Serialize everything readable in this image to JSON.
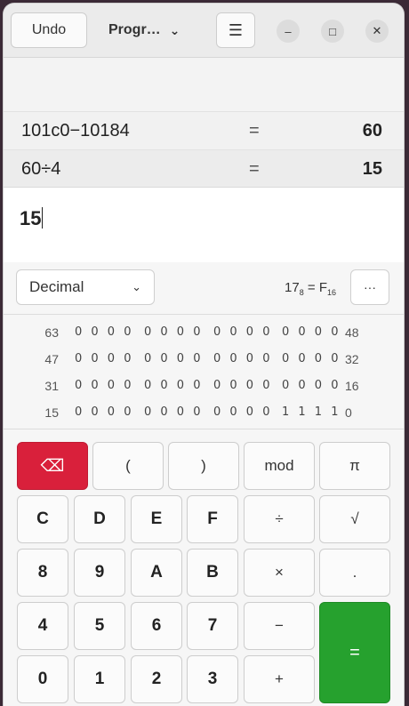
{
  "header": {
    "undo_label": "Undo",
    "mode_label": "Progr…",
    "menu_glyph": "☰",
    "min_glyph": "–",
    "max_glyph": "□",
    "close_glyph": "✕"
  },
  "history": [
    {
      "expr": "101c0−10184",
      "eq": "=",
      "result": "60"
    },
    {
      "expr": "60÷4",
      "eq": "=",
      "result": "15"
    }
  ],
  "input": {
    "value": "15"
  },
  "base": {
    "selected": "Decimal",
    "conv_octal": "17",
    "conv_octal_sub": "8",
    "conv_eq": "=",
    "conv_hex": "F",
    "conv_hex_sub": "16",
    "more_label": "···"
  },
  "bits": [
    {
      "left": "63",
      "n": [
        "0 0 0 0",
        "0 0 0 0",
        "0 0 0 0",
        "0 0 0 0"
      ],
      "right": "48"
    },
    {
      "left": "47",
      "n": [
        "0 0 0 0",
        "0 0 0 0",
        "0 0 0 0",
        "0 0 0 0"
      ],
      "right": "32"
    },
    {
      "left": "31",
      "n": [
        "0 0 0 0",
        "0 0 0 0",
        "0 0 0 0",
        "0 0 0 0"
      ],
      "right": "16"
    },
    {
      "left": "15",
      "n": [
        "0 0 0 0",
        "0 0 0 0",
        "0 0 0 0",
        "1 1 1 1"
      ],
      "right": "0"
    }
  ],
  "keys": {
    "backspace": "⌫",
    "lparen": "(",
    "rparen": ")",
    "mod": "mod",
    "pi": "π",
    "C": "C",
    "D": "D",
    "E": "E",
    "F": "F",
    "divide": "÷",
    "sqrt": "√",
    "8": "8",
    "9": "9",
    "A": "A",
    "B": "B",
    "multiply": "×",
    "dot": ".",
    "4": "4",
    "5": "5",
    "6": "6",
    "7": "7",
    "minus": "−",
    "equals": "=",
    "0": "0",
    "1": "1",
    "2": "2",
    "3": "3",
    "plus": "+"
  },
  "colors": {
    "backspace": "#d9203b",
    "equals": "#26a12e"
  }
}
